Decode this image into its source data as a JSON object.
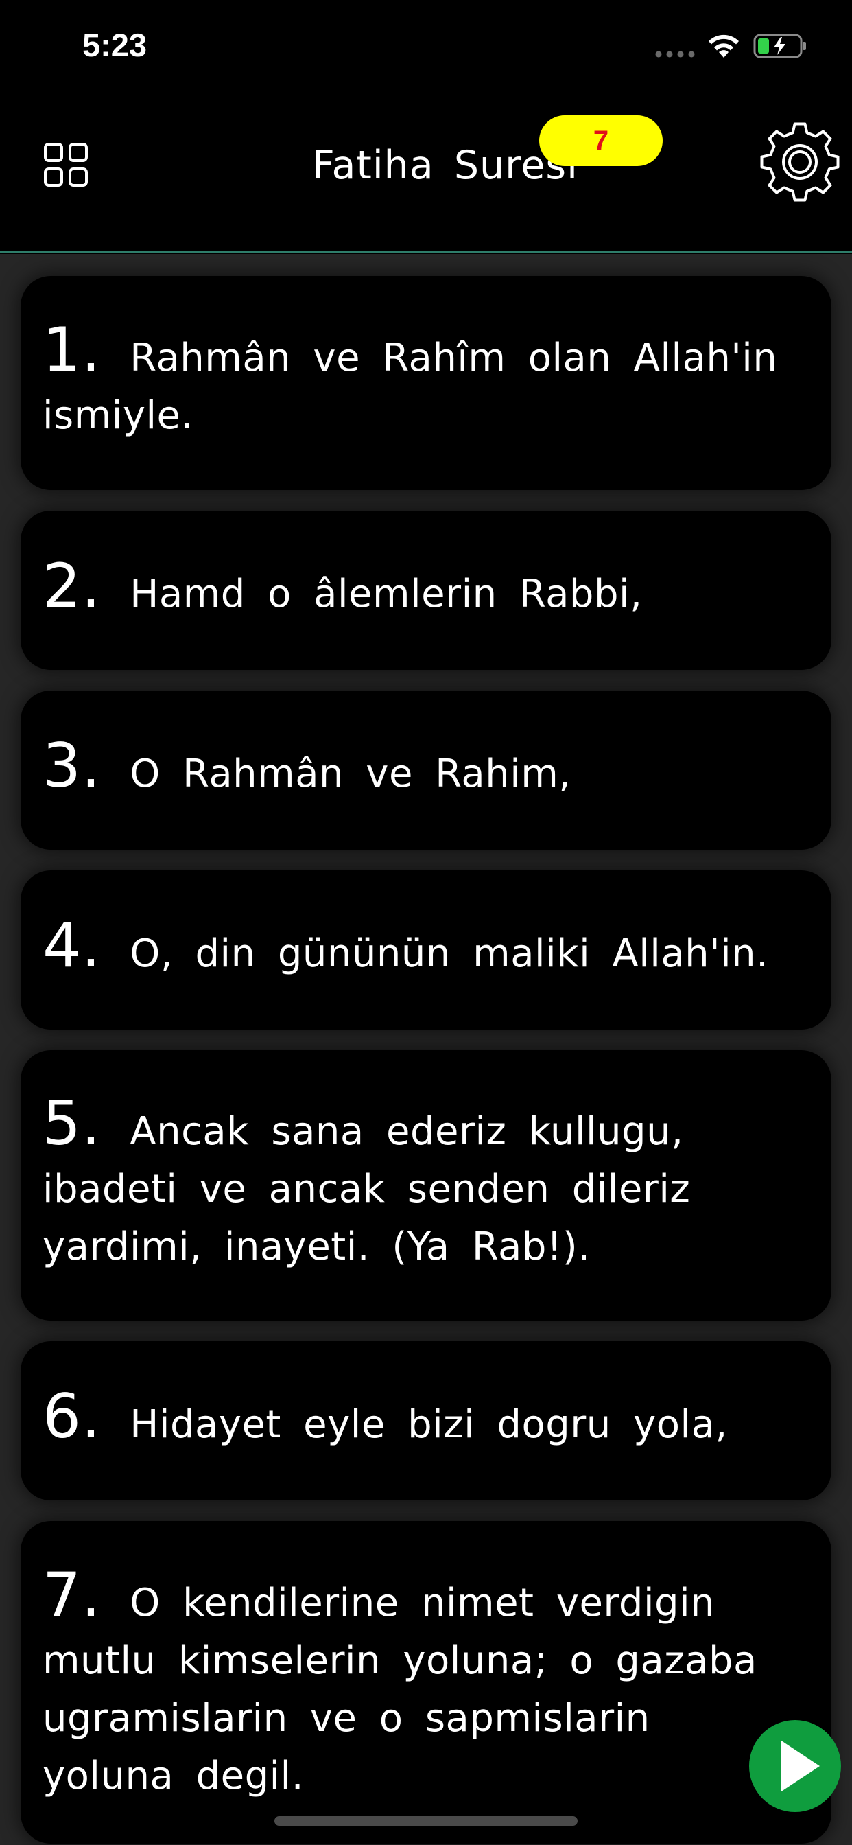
{
  "status_bar": {
    "time": "5:23",
    "signal_icon": "signal-dots-icon",
    "wifi_icon": "wifi-icon",
    "battery_icon": "battery-charging-icon"
  },
  "nav": {
    "menu_icon": "grid-icon",
    "title": "Fatiha Suresi",
    "badge_count": "7",
    "settings_icon": "gear-icon",
    "badge_color": "#ffff00",
    "badge_text_color": "#e0101a",
    "divider_color": "#2e7d6a"
  },
  "verses": [
    {
      "number": "1.",
      "text": "Rahmân ve Rahîm olan Allah'in ismiyle."
    },
    {
      "number": "2.",
      "text": "Hamd o âlemlerin Rabbi,"
    },
    {
      "number": "3.",
      "text": "O Rahmân ve Rahim,"
    },
    {
      "number": "4.",
      "text": "O, din gününün maliki Allah'in."
    },
    {
      "number": "5.",
      "text": "Ancak sana ederiz kullugu, ibadeti ve ancak senden dileriz yardimi, inayeti. (Ya Rab!)."
    },
    {
      "number": "6.",
      "text": "Hidayet eyle bizi dogru yola,"
    },
    {
      "number": "7.",
      "text": "O kendilerine nimet verdigin mutlu kimselerin yoluna; o gazaba ugramislarin ve o sapmislarin yoluna degil."
    }
  ],
  "play_button": {
    "icon": "play-icon",
    "color": "#0f9d3e"
  }
}
